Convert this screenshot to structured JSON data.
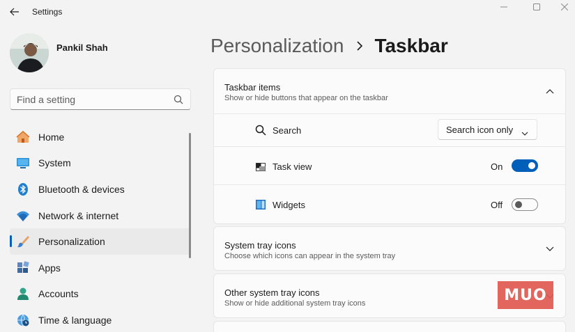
{
  "window": {
    "title": "Settings",
    "controls": [
      "minimize",
      "maximize",
      "close"
    ]
  },
  "user": {
    "name": "Pankil Shah"
  },
  "search": {
    "placeholder": "Find a setting"
  },
  "sidebar": {
    "items": [
      {
        "label": "Home",
        "icon": "home-icon",
        "active": false
      },
      {
        "label": "System",
        "icon": "system-icon",
        "active": false
      },
      {
        "label": "Bluetooth & devices",
        "icon": "bluetooth-icon",
        "active": false
      },
      {
        "label": "Network & internet",
        "icon": "wifi-icon",
        "active": false
      },
      {
        "label": "Personalization",
        "icon": "brush-icon",
        "active": true
      },
      {
        "label": "Apps",
        "icon": "apps-icon",
        "active": false
      },
      {
        "label": "Accounts",
        "icon": "account-icon",
        "active": false
      },
      {
        "label": "Time & language",
        "icon": "globe-clock-icon",
        "active": false
      }
    ]
  },
  "breadcrumb": {
    "parent": "Personalization",
    "current": "Taskbar"
  },
  "sections": {
    "taskbar_items": {
      "title": "Taskbar items",
      "description": "Show or hide buttons that appear on the taskbar",
      "expanded": true,
      "search": {
        "label": "Search",
        "value": "Search icon only"
      },
      "task_view": {
        "label": "Task view",
        "state": "On"
      },
      "widgets": {
        "label": "Widgets",
        "state": "Off"
      }
    },
    "system_tray": {
      "title": "System tray icons",
      "description": "Choose which icons can appear in the system tray",
      "expanded": false
    },
    "other_tray": {
      "title": "Other system tray icons",
      "description": "Show or hide additional system tray icons",
      "expanded": false
    }
  },
  "watermark": {
    "text": "MUO"
  },
  "colors": {
    "accent": "#005fb8",
    "background": "#f3f3f3",
    "card": "#fbfbfb",
    "watermark": "#e05a50"
  }
}
